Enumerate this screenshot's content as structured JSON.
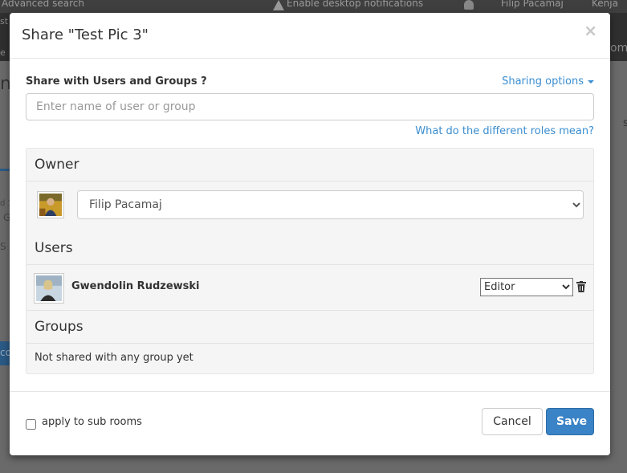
{
  "background": {
    "top_links": {
      "advanced_search": "Advanced search",
      "notifications": "Enable desktop notifications",
      "user_menu": "Filip Pacamaj",
      "other_user": "Kenja"
    },
    "partial_texts": [
      "st",
      "e",
      "om",
      "n",
      "d 1",
      "G",
      "S A",
      "co",
      "s"
    ]
  },
  "modal": {
    "title": "Share \"Test Pic 3\"",
    "close_glyph": "×",
    "share_label": "Share with Users and Groups ?",
    "sharing_options": "Sharing options",
    "search": {
      "placeholder": "Enter name of user or group",
      "value": ""
    },
    "roles_link": "What do the different roles mean?",
    "owner": {
      "heading": "Owner",
      "selected": "Filip Pacamaj",
      "avatar_icon": "user-photo-icon"
    },
    "users": {
      "heading": "Users",
      "items": [
        {
          "name": "Gwendolin Rudzewski",
          "role": "Editor",
          "avatar_icon": "user-photo-icon",
          "delete_icon": "trash-icon"
        }
      ]
    },
    "groups": {
      "heading": "Groups",
      "empty_text": "Not shared with any group yet"
    },
    "footer": {
      "subrooms_label": "apply to sub rooms",
      "subrooms_checked": false,
      "cancel_label": "Cancel",
      "save_label": "Save"
    }
  },
  "colors": {
    "link": "#3a8ed1",
    "primary_button": "#3a83c6",
    "overlay": "#5d5d5d",
    "panel_bg": "#f5f5f5"
  }
}
